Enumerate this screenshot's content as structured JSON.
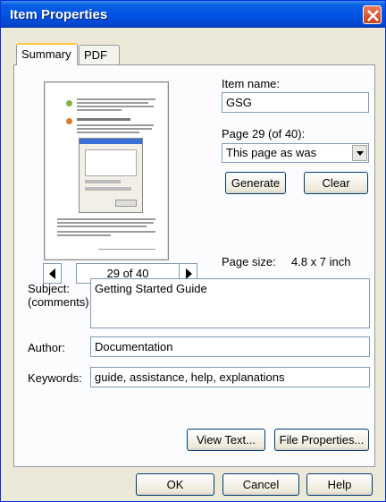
{
  "window": {
    "title": "Item Properties"
  },
  "tabs": [
    {
      "label": "Summary"
    },
    {
      "label": "PDF"
    }
  ],
  "navigator": {
    "page_counter": "29 of 40"
  },
  "item": {
    "name_label": "Item name:",
    "name_value": "GSG",
    "page_label": "Page 29 (of 40):",
    "page_select_value": "This page as was",
    "generate_label": "Generate",
    "clear_label": "Clear",
    "page_size_label": "Page size:",
    "page_size_value": "4.8 x 7 inch"
  },
  "fields": {
    "subject_label_1": "Subject:",
    "subject_label_2": "(comments)",
    "subject_value": "Getting Started Guide",
    "author_label": "Author:",
    "author_value": "Documentation",
    "keywords_label": "Keywords:",
    "keywords_value": "guide, assistance, help, explanations"
  },
  "actions": {
    "view_text": "View Text...",
    "file_properties": "File Properties..."
  },
  "footer": {
    "ok": "OK",
    "cancel": "Cancel",
    "help": "Help"
  },
  "colors": {
    "title_bar": "#0054e3",
    "dialog_bg": "#ece9d8",
    "close": "#c9401c",
    "field_border": "#7f9db9"
  }
}
